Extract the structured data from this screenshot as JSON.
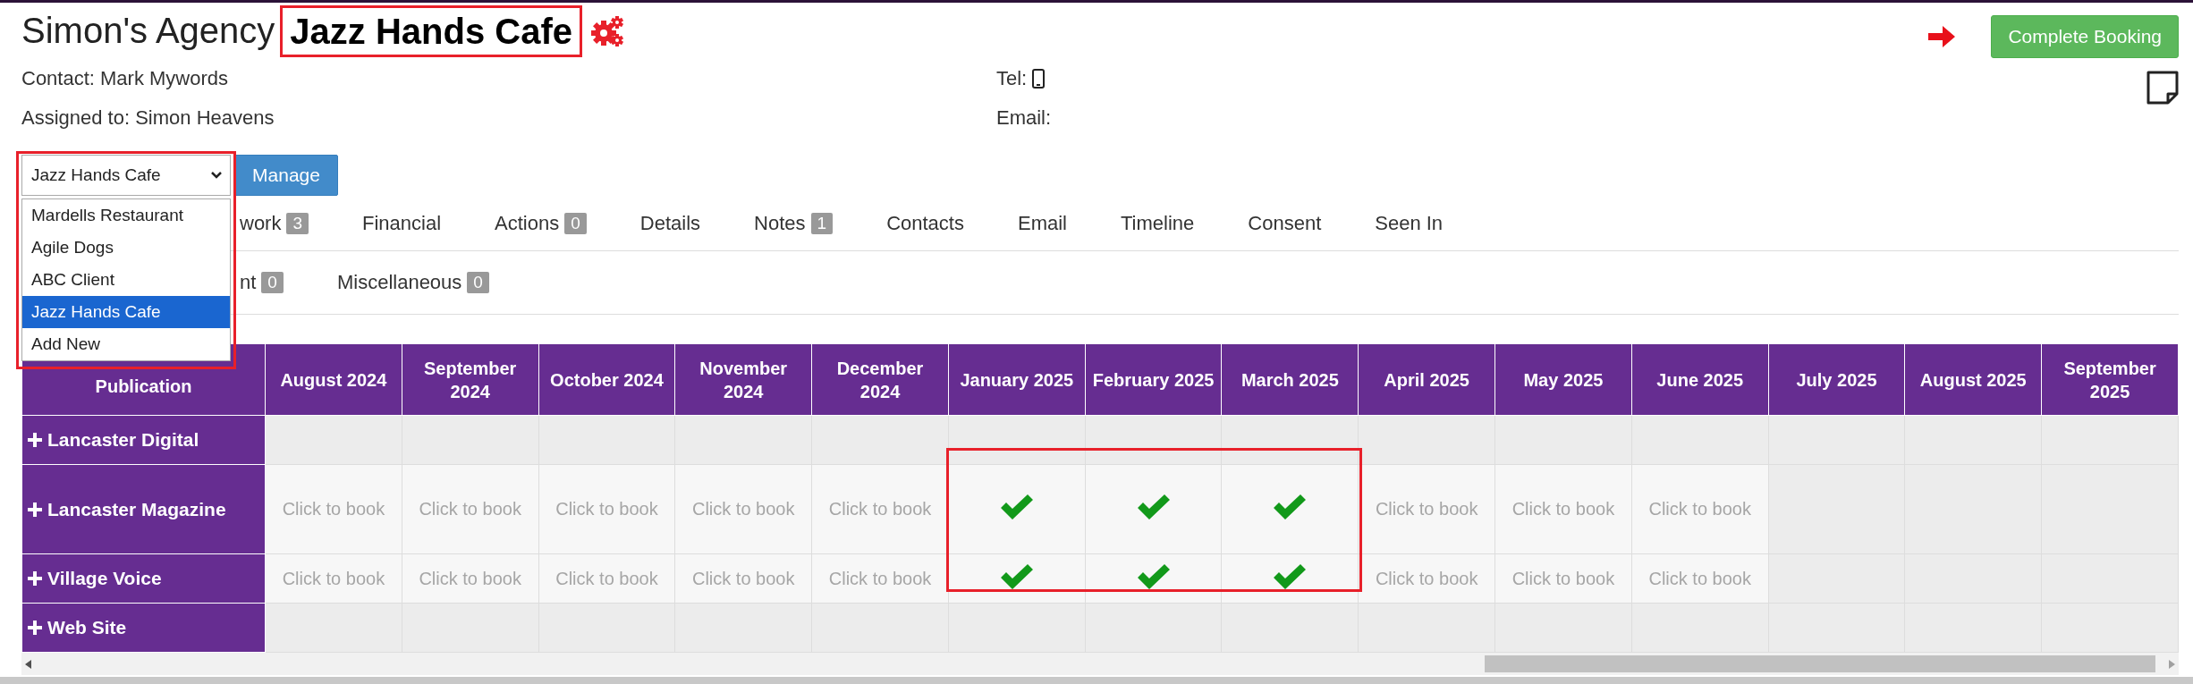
{
  "header": {
    "agency": "Simon's Agency",
    "client": "Jazz Hands Cafe",
    "contact": "Contact: Mark Mywords",
    "assigned": "Assigned to: Simon Heavens",
    "tel_label": "Tel:",
    "email_label": "Email:"
  },
  "complete_button": "Complete Booking",
  "client_select": {
    "value": "Jazz Hands Cafe",
    "options": [
      {
        "label": "Mardells Restaurant",
        "selected": false
      },
      {
        "label": "Agile Dogs",
        "selected": false
      },
      {
        "label": "ABC Client",
        "selected": false
      },
      {
        "label": "Jazz Hands Cafe",
        "selected": true
      },
      {
        "label": "Add New",
        "selected": false
      }
    ]
  },
  "manage_button": "Manage",
  "tabs": [
    {
      "label": "work",
      "badge": "3"
    },
    {
      "label": "Financial"
    },
    {
      "label": "Actions",
      "badge": "0"
    },
    {
      "label": "Details"
    },
    {
      "label": "Notes",
      "badge": "1"
    },
    {
      "label": "Contacts"
    },
    {
      "label": "Email"
    },
    {
      "label": "Timeline"
    },
    {
      "label": "Consent"
    },
    {
      "label": "Seen In"
    }
  ],
  "subtabs": [
    {
      "label": "nt",
      "badge": "0"
    },
    {
      "label": "Miscellaneous",
      "badge": "0"
    }
  ],
  "table": {
    "row_header": "Publication",
    "columns": [
      "August 2024",
      "September 2024",
      "October 2024",
      "November 2024",
      "December 2024",
      "January 2025",
      "February 2025",
      "March 2025",
      "April 2025",
      "May 2025",
      "June 2025",
      "July 2025",
      "August 2025",
      "September 2025"
    ],
    "rows": [
      {
        "name": "Lancaster Digital",
        "tall": false,
        "cells": [
          {
            "kind": "empty"
          },
          {
            "kind": "empty"
          },
          {
            "kind": "empty"
          },
          {
            "kind": "empty"
          },
          {
            "kind": "empty"
          },
          {
            "kind": "empty"
          },
          {
            "kind": "empty"
          },
          {
            "kind": "empty"
          },
          {
            "kind": "empty"
          },
          {
            "kind": "empty"
          },
          {
            "kind": "empty"
          },
          {
            "kind": "empty"
          },
          {
            "kind": "empty"
          },
          {
            "kind": "empty"
          }
        ]
      },
      {
        "name": "Lancaster Magazine",
        "tall": true,
        "cells": [
          {
            "kind": "book",
            "text": "Click to book"
          },
          {
            "kind": "book",
            "text": "Click to book"
          },
          {
            "kind": "book",
            "text": "Click to book"
          },
          {
            "kind": "book",
            "text": "Click to book"
          },
          {
            "kind": "book",
            "text": "Click to book"
          },
          {
            "kind": "booked"
          },
          {
            "kind": "booked"
          },
          {
            "kind": "booked"
          },
          {
            "kind": "book",
            "text": "Click to book"
          },
          {
            "kind": "book",
            "text": "Click to book"
          },
          {
            "kind": "book",
            "text": "Click to book"
          },
          {
            "kind": "empty"
          },
          {
            "kind": "empty"
          },
          {
            "kind": "empty"
          }
        ]
      },
      {
        "name": "Village Voice",
        "tall": false,
        "cells": [
          {
            "kind": "book",
            "text": "Click to book"
          },
          {
            "kind": "book",
            "text": "Click to book"
          },
          {
            "kind": "book",
            "text": "Click to book"
          },
          {
            "kind": "book",
            "text": "Click to book"
          },
          {
            "kind": "book",
            "text": "Click to book"
          },
          {
            "kind": "booked"
          },
          {
            "kind": "booked"
          },
          {
            "kind": "booked"
          },
          {
            "kind": "book",
            "text": "Click to book"
          },
          {
            "kind": "book",
            "text": "Click to book"
          },
          {
            "kind": "book",
            "text": "Click to book"
          },
          {
            "kind": "empty"
          },
          {
            "kind": "empty"
          },
          {
            "kind": "empty"
          }
        ]
      },
      {
        "name": "Web Site",
        "tall": false,
        "cells": [
          {
            "kind": "empty"
          },
          {
            "kind": "empty"
          },
          {
            "kind": "empty"
          },
          {
            "kind": "empty"
          },
          {
            "kind": "empty"
          },
          {
            "kind": "empty"
          },
          {
            "kind": "empty"
          },
          {
            "kind": "empty"
          },
          {
            "kind": "empty"
          },
          {
            "kind": "empty"
          },
          {
            "kind": "empty"
          },
          {
            "kind": "empty"
          },
          {
            "kind": "empty"
          },
          {
            "kind": "empty"
          }
        ]
      }
    ]
  }
}
